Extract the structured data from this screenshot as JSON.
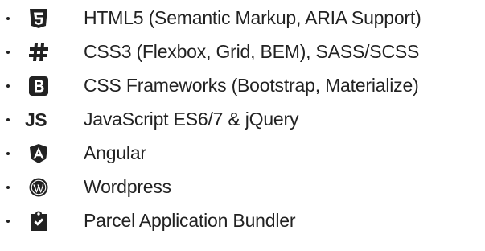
{
  "skills": [
    {
      "icon": "html5-icon",
      "label": "HTML5 (Semantic Markup, ARIA Support)"
    },
    {
      "icon": "css3-hash-icon",
      "label": "CSS3 (Flexbox, Grid, BEM), SASS/SCSS"
    },
    {
      "icon": "bootstrap-icon",
      "label": "CSS Frameworks (Bootstrap, Materialize)"
    },
    {
      "icon": "javascript-icon",
      "icon_text": "JS",
      "label": "JavaScript ES6/7 & jQuery"
    },
    {
      "icon": "angular-icon",
      "label": "Angular"
    },
    {
      "icon": "wordpress-icon",
      "label": "Wordpress"
    },
    {
      "icon": "clipboard-check-icon",
      "label": "Parcel Application Bundler"
    }
  ],
  "colors": {
    "text": "#222222",
    "background": "#ffffff"
  }
}
